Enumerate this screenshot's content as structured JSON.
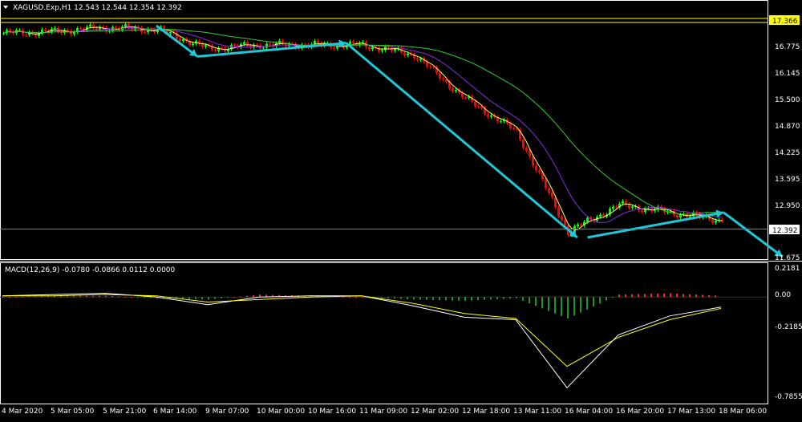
{
  "header": {
    "menu_icon": "triangle-down-icon",
    "symbol_line": "XAGUSD.Exp,H1  12.543 12.544 12.354 12.392"
  },
  "price_axis": {
    "labels": [
      "16.775",
      "16.145",
      "15.500",
      "14.870",
      "14.225",
      "13.595",
      "12.950",
      "11.675"
    ],
    "current_price": "12.392",
    "hline_price": "17.366"
  },
  "macd": {
    "label": "MACD(12,26,9) -0.0780 -0.0866 0.0112 0.0000",
    "axis_labels": [
      "0.2181",
      "0.00",
      "-0.2185",
      "-0.7855"
    ]
  },
  "time_axis": {
    "labels": [
      "4 Mar 2020",
      "5 Mar 05:00",
      "5 Mar 21:00",
      "6 Mar 14:00",
      "9 Mar 07:00",
      "10 Mar 00:00",
      "10 Mar 16:00",
      "11 Mar 09:00",
      "12 Mar 02:00",
      "12 Mar 18:00",
      "13 Mar 11:00",
      "16 Mar 04:00",
      "16 Mar 20:00",
      "17 Mar 13:00",
      "18 Mar 06:00"
    ]
  },
  "colors": {
    "background": "#000000",
    "bull_candle": "#00ff00",
    "bear_candle": "#ff0000",
    "hline": "#ffff00",
    "price_line": "#708090",
    "arrow": "#1ec8d8",
    "ma_fast": "#ffff66",
    "ma_mid": "#8a2be2",
    "ma_slow": "#32cd32",
    "macd_main": "#ffffff",
    "macd_signal": "#ffff00",
    "macd_hist_pos": "#ff2020",
    "macd_hist_neg": "#1a9a1a"
  },
  "chart_data": [
    {
      "type": "line",
      "title": "XAGUSD.Exp,H1",
      "ylim": [
        11.45,
        17.95
      ],
      "x": [
        "4 Mar 2020",
        "5 Mar 05:00",
        "5 Mar 21:00",
        "6 Mar 14:00",
        "9 Mar 07:00",
        "10 Mar 00:00",
        "10 Mar 16:00",
        "11 Mar 09:00",
        "12 Mar 02:00",
        "12 Mar 18:00",
        "13 Mar 11:00",
        "16 Mar 04:00",
        "16 Mar 20:00",
        "17 Mar 13:00",
        "18 Mar 06:00"
      ],
      "series": [
        {
          "values": [
            17.25,
            17.3,
            17.4,
            17.35,
            16.85,
            16.95,
            16.95,
            16.95,
            16.7,
            15.55,
            14.7,
            12.1,
            12.8,
            12.6,
            12.39
          ]
        }
      ],
      "horizontal_lines": [
        17.366,
        12.392
      ]
    },
    {
      "type": "bar",
      "title": "MACD(12,26,9)",
      "ylim": [
        -0.82,
        0.25
      ],
      "x": [
        "4 Mar 2020",
        "5 Mar 05:00",
        "5 Mar 21:00",
        "6 Mar 14:00",
        "9 Mar 07:00",
        "10 Mar 00:00",
        "10 Mar 16:00",
        "11 Mar 09:00",
        "12 Mar 02:00",
        "12 Mar 18:00",
        "13 Mar 11:00",
        "16 Mar 04:00",
        "16 Mar 20:00",
        "17 Mar 13:00",
        "18 Mar 06:00"
      ],
      "series": [
        {
          "values": [
            0.01,
            0.02,
            0.03,
            0.0,
            -0.06,
            0.0,
            0.01,
            0.01,
            -0.07,
            -0.16,
            -0.18,
            -0.72,
            -0.3,
            -0.15,
            -0.08
          ]
        },
        {
          "values": [
            0.01,
            0.01,
            0.02,
            0.01,
            -0.04,
            -0.02,
            0.0,
            0.01,
            -0.05,
            -0.13,
            -0.17,
            -0.55,
            -0.32,
            -0.18,
            -0.09
          ]
        }
      ]
    }
  ]
}
